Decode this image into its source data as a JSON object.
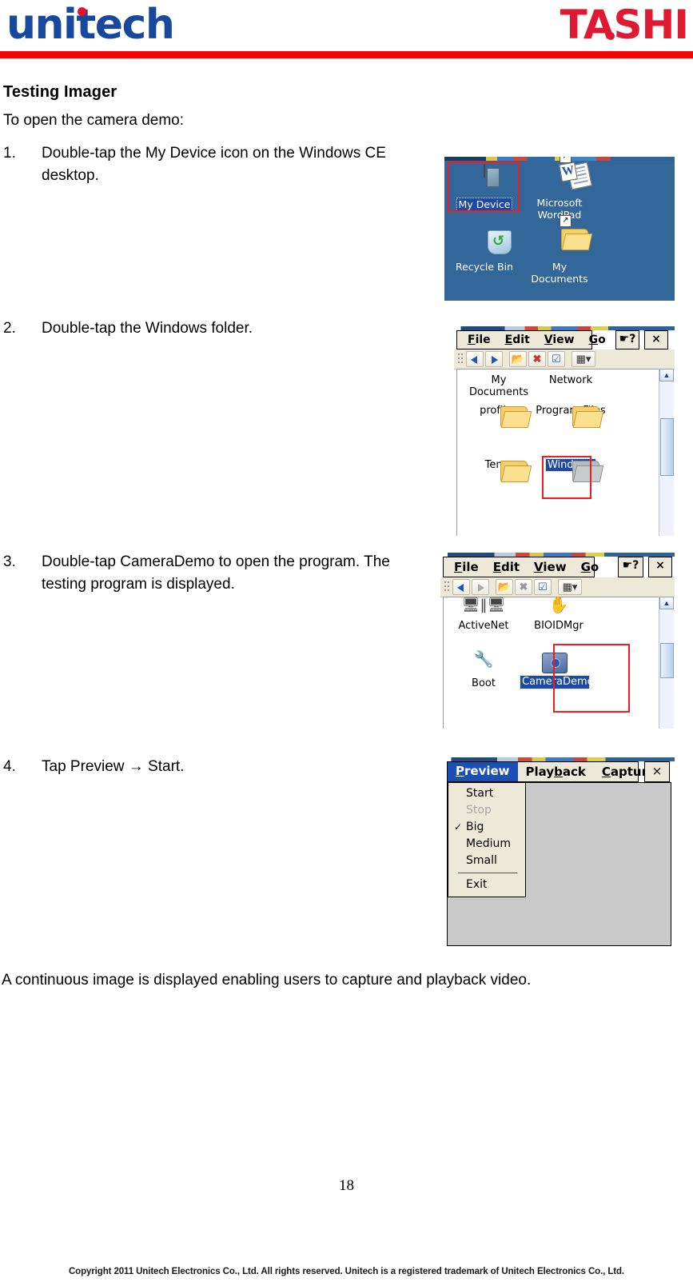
{
  "header": {
    "brand_left": "unitech",
    "brand_right": "TASHI",
    "brand_left_color": "#17489e",
    "brand_right_color": "#e01933",
    "rule_color": "#ff0000"
  },
  "document": {
    "section_title": "Testing Imager",
    "intro": "To open the camera demo:",
    "steps": [
      {
        "num": "1.",
        "text": "Double-tap the My Device icon on the Windows CE desktop."
      },
      {
        "num": "2.",
        "text": "Double-tap the Windows folder."
      },
      {
        "num": "3.",
        "text": "Double-tap CameraDemo to open the program. The testing program is displayed."
      },
      {
        "num": "4.",
        "text": "Tap Preview  →  Start."
      }
    ],
    "closing": "A continuous image is displayed enabling users to capture and playback video.",
    "page_number": "18",
    "footer": "Copyright 2011 Unitech Electronics Co., Ltd. All rights reserved. Unitech is a registered trademark of Unitech Electronics Co., Ltd."
  },
  "shot_desktop": {
    "name": "windows-ce-desktop",
    "background_color": "#336699",
    "icons": [
      {
        "label": "My Device",
        "icon": "pda-device-icon",
        "selected": true,
        "highlighted": true
      },
      {
        "label": "Microsoft WordPad",
        "icon": "wordpad-icon",
        "selected": false,
        "highlighted": false
      },
      {
        "label": "Recycle Bin",
        "icon": "recycle-bin-icon",
        "selected": false,
        "highlighted": false
      },
      {
        "label": "My Documents",
        "icon": "folder-shortcut-icon",
        "selected": false,
        "highlighted": false
      }
    ]
  },
  "shot_explorer_root": {
    "name": "my-device-explorer",
    "menu": [
      {
        "label": "File",
        "accel": "F"
      },
      {
        "label": "Edit",
        "accel": "E"
      },
      {
        "label": "View",
        "accel": "V"
      },
      {
        "label": "Go",
        "accel": "G"
      }
    ],
    "help_button": "?",
    "close_button": "×",
    "toolbar": [
      "back-icon",
      "forward-icon",
      "up-folder-icon",
      "delete-icon",
      "properties-icon",
      "views-icon"
    ],
    "files": [
      {
        "label": "My Documents",
        "icon": "folder-icon",
        "highlighted": false
      },
      {
        "label": "Network",
        "icon": "network-icon",
        "highlighted": false
      },
      {
        "label": "profiles",
        "icon": "folder-icon",
        "highlighted": false
      },
      {
        "label": "Program Files",
        "icon": "folder-icon",
        "highlighted": false
      },
      {
        "label": "Temp",
        "icon": "folder-icon",
        "highlighted": false
      },
      {
        "label": "Windows",
        "icon": "folder-icon-grey",
        "highlighted": true,
        "selected": true
      }
    ]
  },
  "shot_explorer_windows": {
    "name": "windows-folder-explorer",
    "menu": [
      {
        "label": "File",
        "accel": "F"
      },
      {
        "label": "Edit",
        "accel": "E"
      },
      {
        "label": "View",
        "accel": "V"
      },
      {
        "label": "Go",
        "accel": "G"
      }
    ],
    "help_button": "?",
    "close_button": "×",
    "files": [
      {
        "label": "ActiveNet",
        "icon": "activenet-icon",
        "highlighted": false
      },
      {
        "label": "BIOIDMgr",
        "icon": "bioidmgr-hand-icon",
        "highlighted": false
      },
      {
        "label": "Boot",
        "icon": "boot-icon",
        "highlighted": false
      },
      {
        "label": "CameraDemo",
        "icon": "camera-demo-icon",
        "highlighted": true,
        "selected": true
      }
    ]
  },
  "shot_camera_demo": {
    "name": "camera-demo-window",
    "menu": [
      {
        "label": "Preview",
        "accel": "P",
        "active": true
      },
      {
        "label": "Playback",
        "accel": "b",
        "active": false
      },
      {
        "label": "Capture",
        "accel": "C",
        "active": false
      }
    ],
    "close_button": "×",
    "dropdown": [
      {
        "label": "Start",
        "state": "highlighted",
        "checked": false
      },
      {
        "label": "Stop",
        "state": "disabled",
        "checked": false
      },
      {
        "label": "Big",
        "state": "normal",
        "checked": true
      },
      {
        "label": "Medium",
        "state": "normal",
        "checked": false
      },
      {
        "label": "Small",
        "state": "normal",
        "checked": false
      },
      {
        "label": "__divider__",
        "state": "divider",
        "checked": false
      },
      {
        "label": "Exit",
        "state": "normal",
        "checked": false
      }
    ],
    "viewport_color": "#c9c9c9"
  },
  "annotations": {
    "highlight_color": "#ef1c22",
    "selection_color": "#1b4aa0"
  }
}
